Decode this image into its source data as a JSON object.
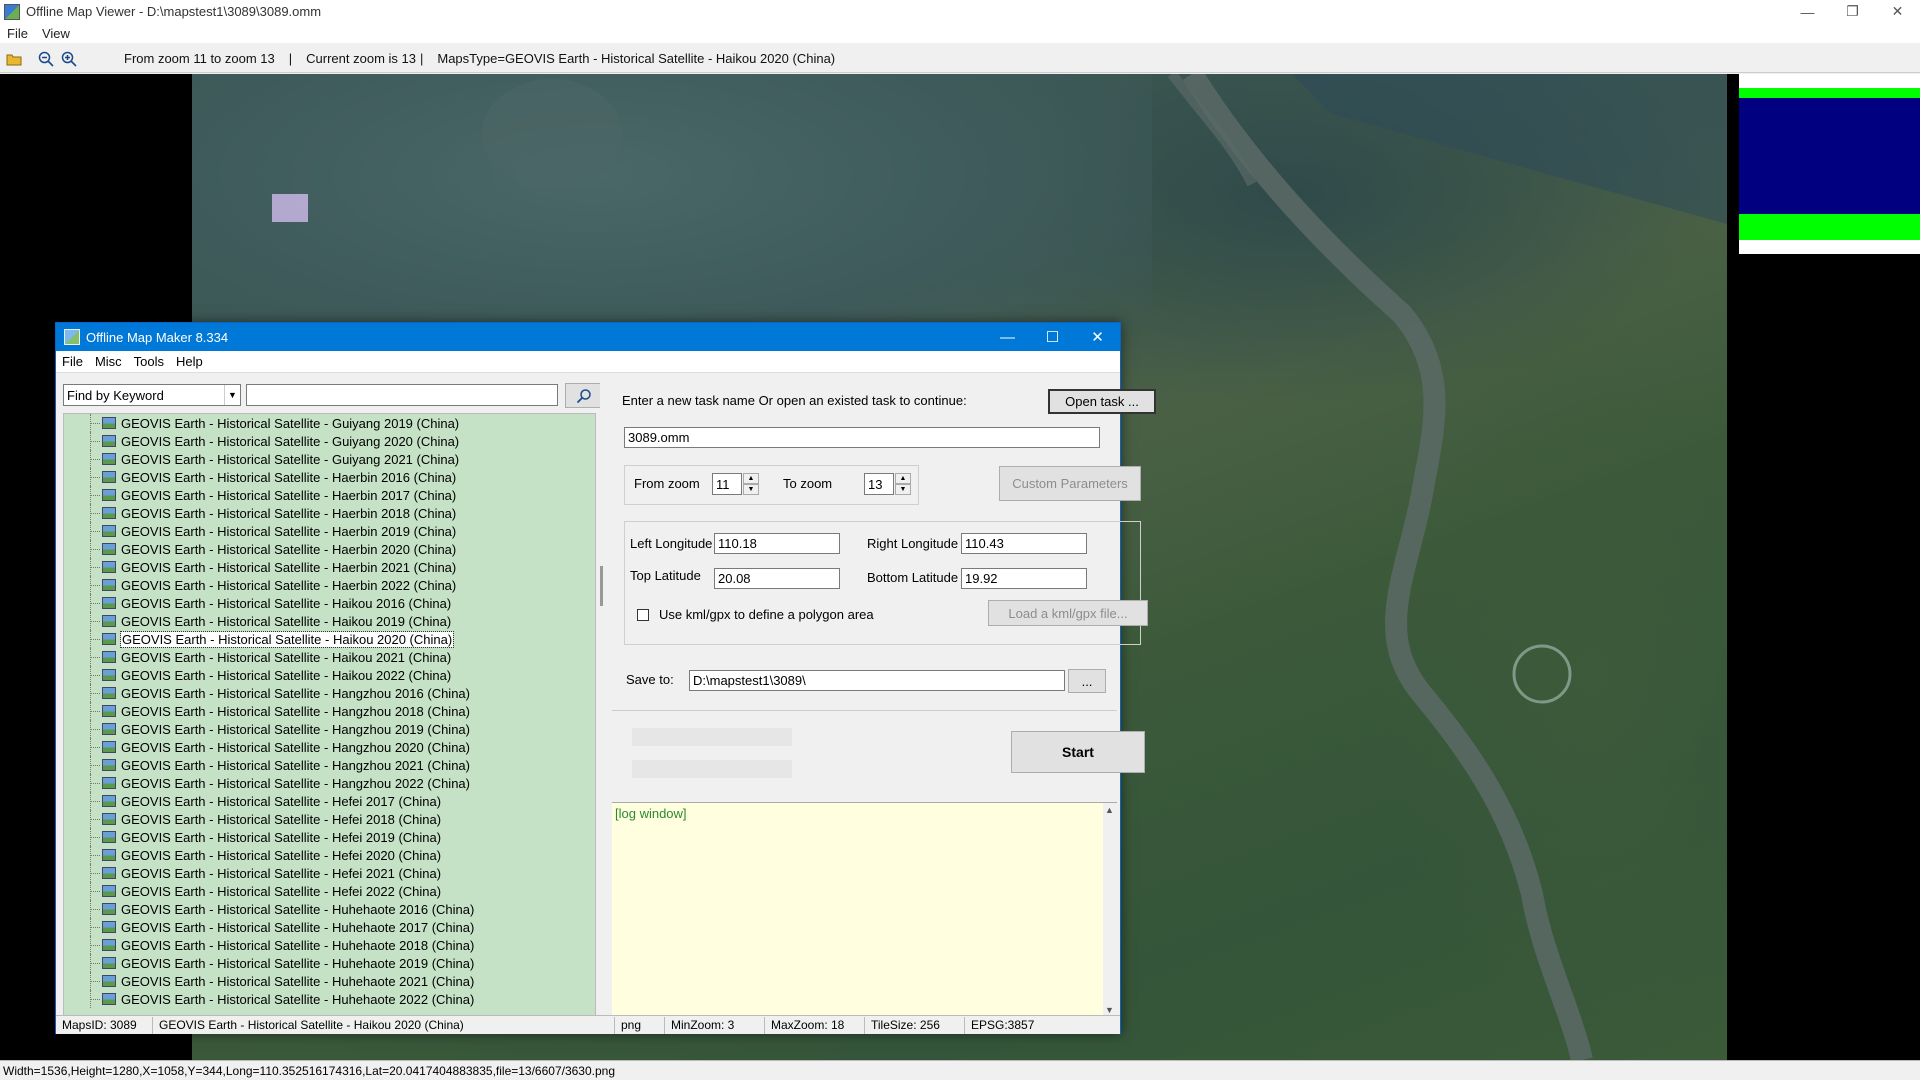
{
  "window": {
    "title": "Offline Map Viewer - D:\\mapstest1\\3089\\3089.omm",
    "controls": {
      "minimize": "—",
      "maximize": "❐",
      "close": "✕"
    }
  },
  "menu": [
    "File",
    "View"
  ],
  "toolbar": {
    "zoom_range": "From zoom 11 to zoom 13",
    "separator1": "|",
    "current_zoom": "Current zoom is 13",
    "separator2": "|",
    "maps_type": "MapsType=GEOVIS Earth - Historical Satellite - Haikou 2020 (China)"
  },
  "status_bar": "Width=1536,Height=1280,X=1058,Y=344,Long=110.352516174316,Lat=20.0417404883835,file=13/6607/3630.png",
  "dialog": {
    "title": "Offline Map Maker 8.334",
    "controls": {
      "minimize": "—",
      "maximize": "☐",
      "close": "✕"
    },
    "menu": [
      "File",
      "Misc",
      "Tools",
      "Help"
    ],
    "find_mode": "Find by Keyword",
    "search_value": "",
    "tree_items": [
      "GEOVIS Earth - Historical Satellite - Guiyang 2019 (China)",
      "GEOVIS Earth - Historical Satellite - Guiyang 2020 (China)",
      "GEOVIS Earth - Historical Satellite - Guiyang 2021 (China)",
      "GEOVIS Earth - Historical Satellite - Haerbin 2016 (China)",
      "GEOVIS Earth - Historical Satellite - Haerbin 2017 (China)",
      "GEOVIS Earth - Historical Satellite - Haerbin 2018 (China)",
      "GEOVIS Earth - Historical Satellite - Haerbin 2019 (China)",
      "GEOVIS Earth - Historical Satellite - Haerbin 2020 (China)",
      "GEOVIS Earth - Historical Satellite - Haerbin 2021 (China)",
      "GEOVIS Earth - Historical Satellite - Haerbin 2022 (China)",
      "GEOVIS Earth - Historical Satellite - Haikou 2016 (China)",
      "GEOVIS Earth - Historical Satellite - Haikou 2019 (China)",
      "GEOVIS Earth - Historical Satellite - Haikou 2020 (China)",
      "GEOVIS Earth - Historical Satellite - Haikou 2021 (China)",
      "GEOVIS Earth - Historical Satellite - Haikou 2022 (China)",
      "GEOVIS Earth - Historical Satellite - Hangzhou 2016 (China)",
      "GEOVIS Earth - Historical Satellite - Hangzhou 2018 (China)",
      "GEOVIS Earth - Historical Satellite - Hangzhou 2019 (China)",
      "GEOVIS Earth - Historical Satellite - Hangzhou 2020 (China)",
      "GEOVIS Earth - Historical Satellite - Hangzhou 2021 (China)",
      "GEOVIS Earth - Historical Satellite - Hangzhou 2022 (China)",
      "GEOVIS Earth - Historical Satellite - Hefei 2017 (China)",
      "GEOVIS Earth - Historical Satellite - Hefei 2018 (China)",
      "GEOVIS Earth - Historical Satellite - Hefei 2019 (China)",
      "GEOVIS Earth - Historical Satellite - Hefei 2020 (China)",
      "GEOVIS Earth - Historical Satellite - Hefei 2021 (China)",
      "GEOVIS Earth - Historical Satellite - Hefei 2022 (China)",
      "GEOVIS Earth - Historical Satellite - Huhehaote 2016 (China)",
      "GEOVIS Earth - Historical Satellite - Huhehaote 2017 (China)",
      "GEOVIS Earth - Historical Satellite - Huhehaote 2018 (China)",
      "GEOVIS Earth - Historical Satellite - Huhehaote 2019 (China)",
      "GEOVIS Earth - Historical Satellite - Huhehaote 2021 (China)",
      "GEOVIS Earth - Historical Satellite - Huhehaote 2022 (China)"
    ],
    "selected_item": "GEOVIS Earth - Historical Satellite - Haikou 2020 (China)",
    "task_prompt": "Enter a new task name Or open an existed task to continue:",
    "open_task_label": "Open task ...",
    "task_name": "3089.omm",
    "from_zoom_label": "From zoom",
    "from_zoom": "11",
    "to_zoom_label": "To zoom",
    "to_zoom": "13",
    "custom_params_label": "Custom Parameters",
    "left_longitude_label": "Left Longitude",
    "left_longitude": "110.18",
    "right_longitude_label": "Right Longitude",
    "right_longitude": "110.43",
    "top_latitude_label": "Top Latitude",
    "top_latitude": "20.08",
    "bottom_latitude_label": "Bottom Latitude",
    "bottom_latitude": "19.92",
    "use_kml_label": "Use kml/gpx to define a polygon area",
    "use_kml_checked": false,
    "load_kml_label": "Load a kml/gpx file...",
    "save_to_label": "Save to:",
    "save_to": "D:\\mapstest1\\3089\\",
    "browse_label": "...",
    "start_label": "Start",
    "log_text": "[log window]",
    "status": {
      "maps_id": "MapsID: 3089",
      "map_name": "GEOVIS Earth - Historical Satellite - Haikou 2020 (China)",
      "format": "png",
      "min_zoom": "MinZoom: 3",
      "max_zoom": "MaxZoom: 18",
      "tile_size": "TileSize: 256",
      "epsg": "EPSG:3857"
    }
  },
  "colors": {
    "dialog_title": "#0078d7",
    "tree_bg": "#c6e2c6",
    "log_bg": "#ffffe0",
    "legend_green": "#00ff00",
    "legend_blue": "#000080"
  }
}
